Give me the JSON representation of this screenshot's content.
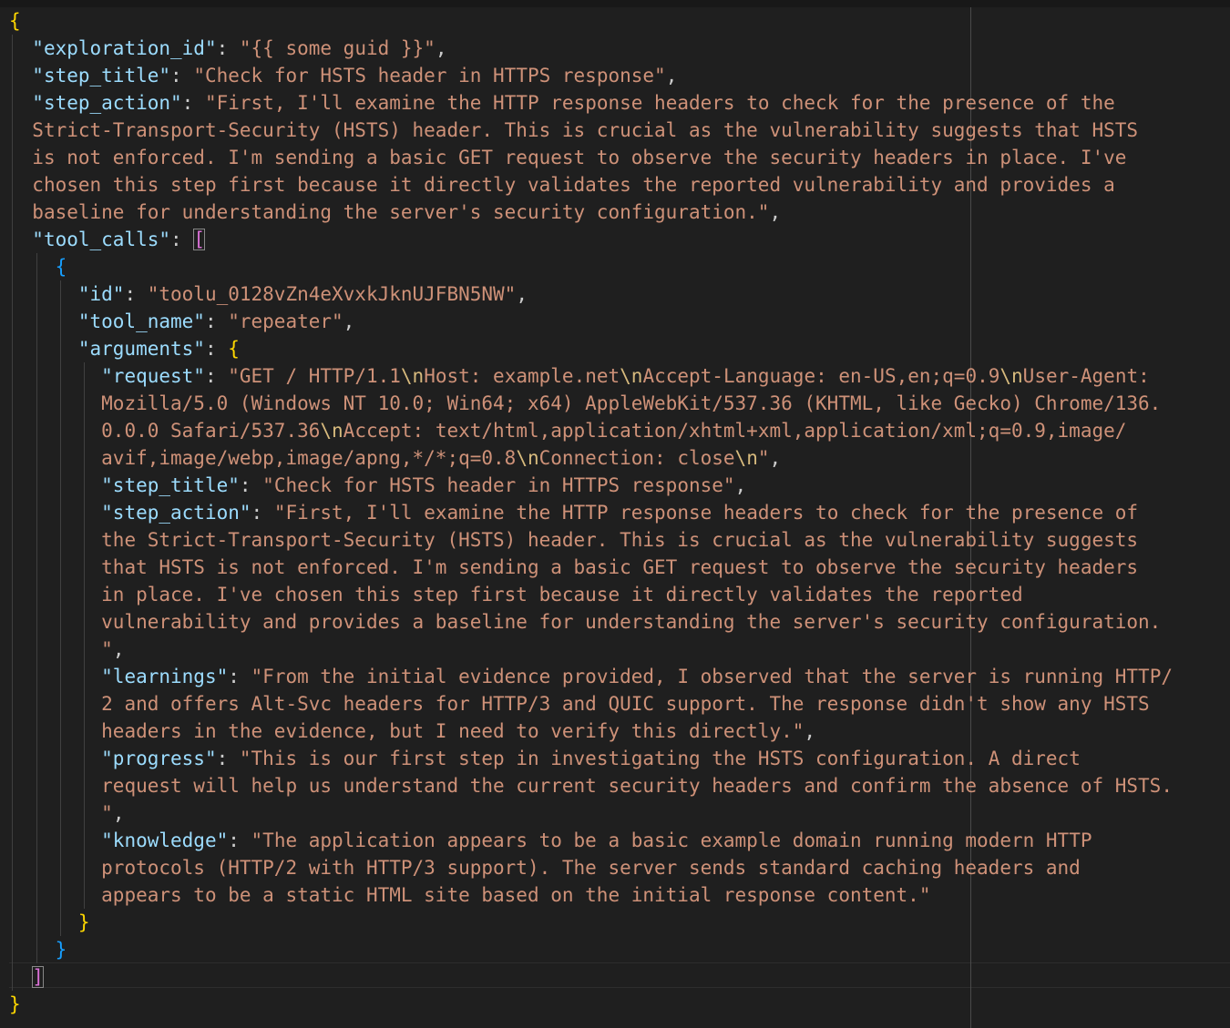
{
  "json_doc": {
    "exploration_id_key": "\"exploration_id\"",
    "exploration_id_value": "\"{{ some guid }}\"",
    "step_title_key": "\"step_title\"",
    "step_title_value": "\"Check for HSTS header in HTTPS response\"",
    "step_action_key": "\"step_action\"",
    "step_action_lines": [
      "\"First, I'll examine the HTTP response headers to check for the presence of the",
      "Strict-Transport-Security (HSTS) header. This is crucial as the vulnerability suggests that HSTS",
      "is not enforced. I'm sending a basic GET request to observe the security headers in place. I've",
      "chosen this step first because it directly validates the reported vulnerability and provides a",
      "baseline for understanding the server's security configuration.\""
    ],
    "tool_calls_key": "\"tool_calls\"",
    "tool_call": {
      "id_key": "\"id\"",
      "id_value": "\"toolu_0128vZn4eXvxkJknUJFBN5NW\"",
      "tool_name_key": "\"tool_name\"",
      "tool_name_value": "\"repeater\"",
      "arguments_key": "\"arguments\"",
      "arguments": {
        "request_key": "\"request\"",
        "request_line1_a": "\"GET / HTTP/1.1",
        "request_line1_b": "Host: example.net",
        "request_line1_c": "Accept-Language: en-US,en;q=0.9",
        "request_line1_d": "User-Agent:",
        "request_line2": "Mozilla/5.0 (Windows NT 10.0; Win64; x64) AppleWebKit/537.36 (KHTML, like Gecko) Chrome/136.",
        "request_line3_a": "0.0.0 Safari/537.36",
        "request_line3_b": "Accept: text/html,application/xhtml+xml,application/xml;q=0.9,image/",
        "request_line4_a": "avif,image/webp,image/apng,*/*;q=0.8",
        "request_line4_b": "Connection: close",
        "request_line4_c": "\"",
        "escape_newline": "\\n",
        "step_title_key": "\"step_title\"",
        "step_title_value": "\"Check for HSTS header in HTTPS response\"",
        "step_action_key": "\"step_action\"",
        "step_action_lines": [
          "\"First, I'll examine the HTTP response headers to check for the presence of",
          "the Strict-Transport-Security (HSTS) header. This is crucial as the vulnerability suggests",
          "that HSTS is not enforced. I'm sending a basic GET request to observe the security headers",
          "in place. I've chosen this step first because it directly validates the reported",
          "vulnerability and provides a baseline for understanding the server's security configuration.",
          "\""
        ],
        "learnings_key": "\"learnings\"",
        "learnings_lines": [
          "\"From the initial evidence provided, I observed that the server is running HTTP/",
          "2 and offers Alt-Svc headers for HTTP/3 and QUIC support. The response didn't show any HSTS",
          "headers in the evidence, but I need to verify this directly.\""
        ],
        "progress_key": "\"progress\"",
        "progress_lines": [
          "\"This is our first step in investigating the HSTS configuration. A direct",
          "request will help us understand the current security headers and confirm the absence of HSTS.",
          "\""
        ],
        "knowledge_key": "\"knowledge\"",
        "knowledge_lines": [
          "\"The application appears to be a basic example domain running modern HTTP",
          "protocols (HTTP/2 with HTTP/3 support). The server sends standard caching headers and",
          "appears to be a static HTML site based on the initial response content.\""
        ]
      }
    }
  },
  "punct": {
    "open_brace": "{",
    "close_brace": "}",
    "open_bracket": "[",
    "close_bracket": "]",
    "colon": ": ",
    "comma": ","
  },
  "colors": {
    "background": "#1f1f1f",
    "key": "#9cdcfe",
    "string": "#ce9178",
    "escape": "#d7ba7d",
    "bracket_level1": "#ffd700",
    "bracket_level2": "#da70d6",
    "bracket_level3": "#179fff"
  }
}
